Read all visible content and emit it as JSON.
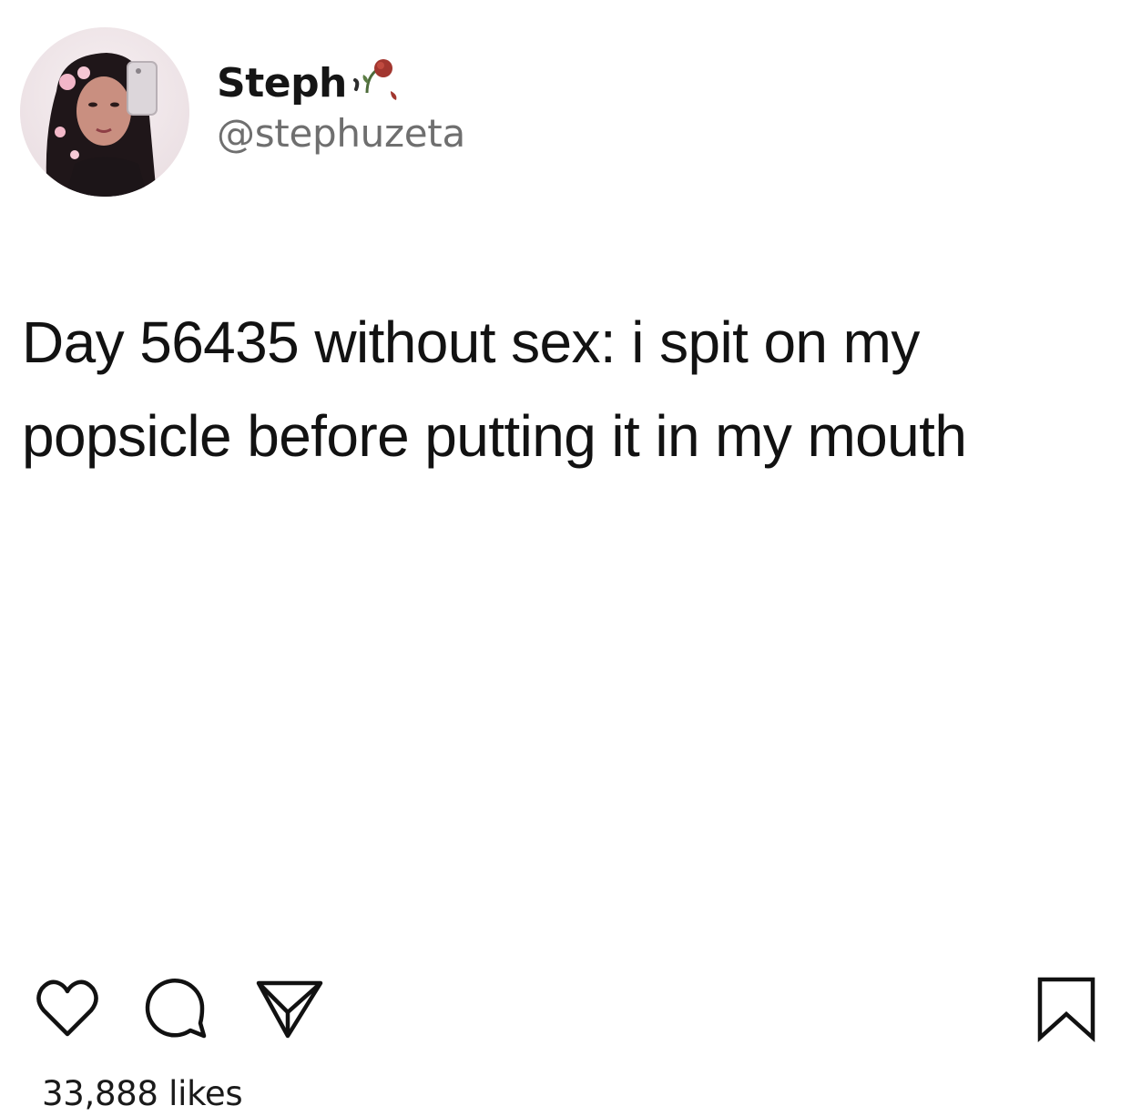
{
  "post": {
    "display_name": "Steph",
    "name_emoji": "wilted-rose-emoji",
    "handle": "@stephuzeta",
    "text": "Day 56435 without sex: i spit on my popsicle before putting it in my mouth"
  },
  "actions": {
    "like": "heart-icon",
    "comment": "speech-bubble-icon",
    "share": "paper-plane-icon",
    "save": "bookmark-icon"
  },
  "likes": "33,888 likes",
  "colors": {
    "text": "#121212",
    "handle": "#6f6f6f",
    "background": "#ffffff"
  }
}
